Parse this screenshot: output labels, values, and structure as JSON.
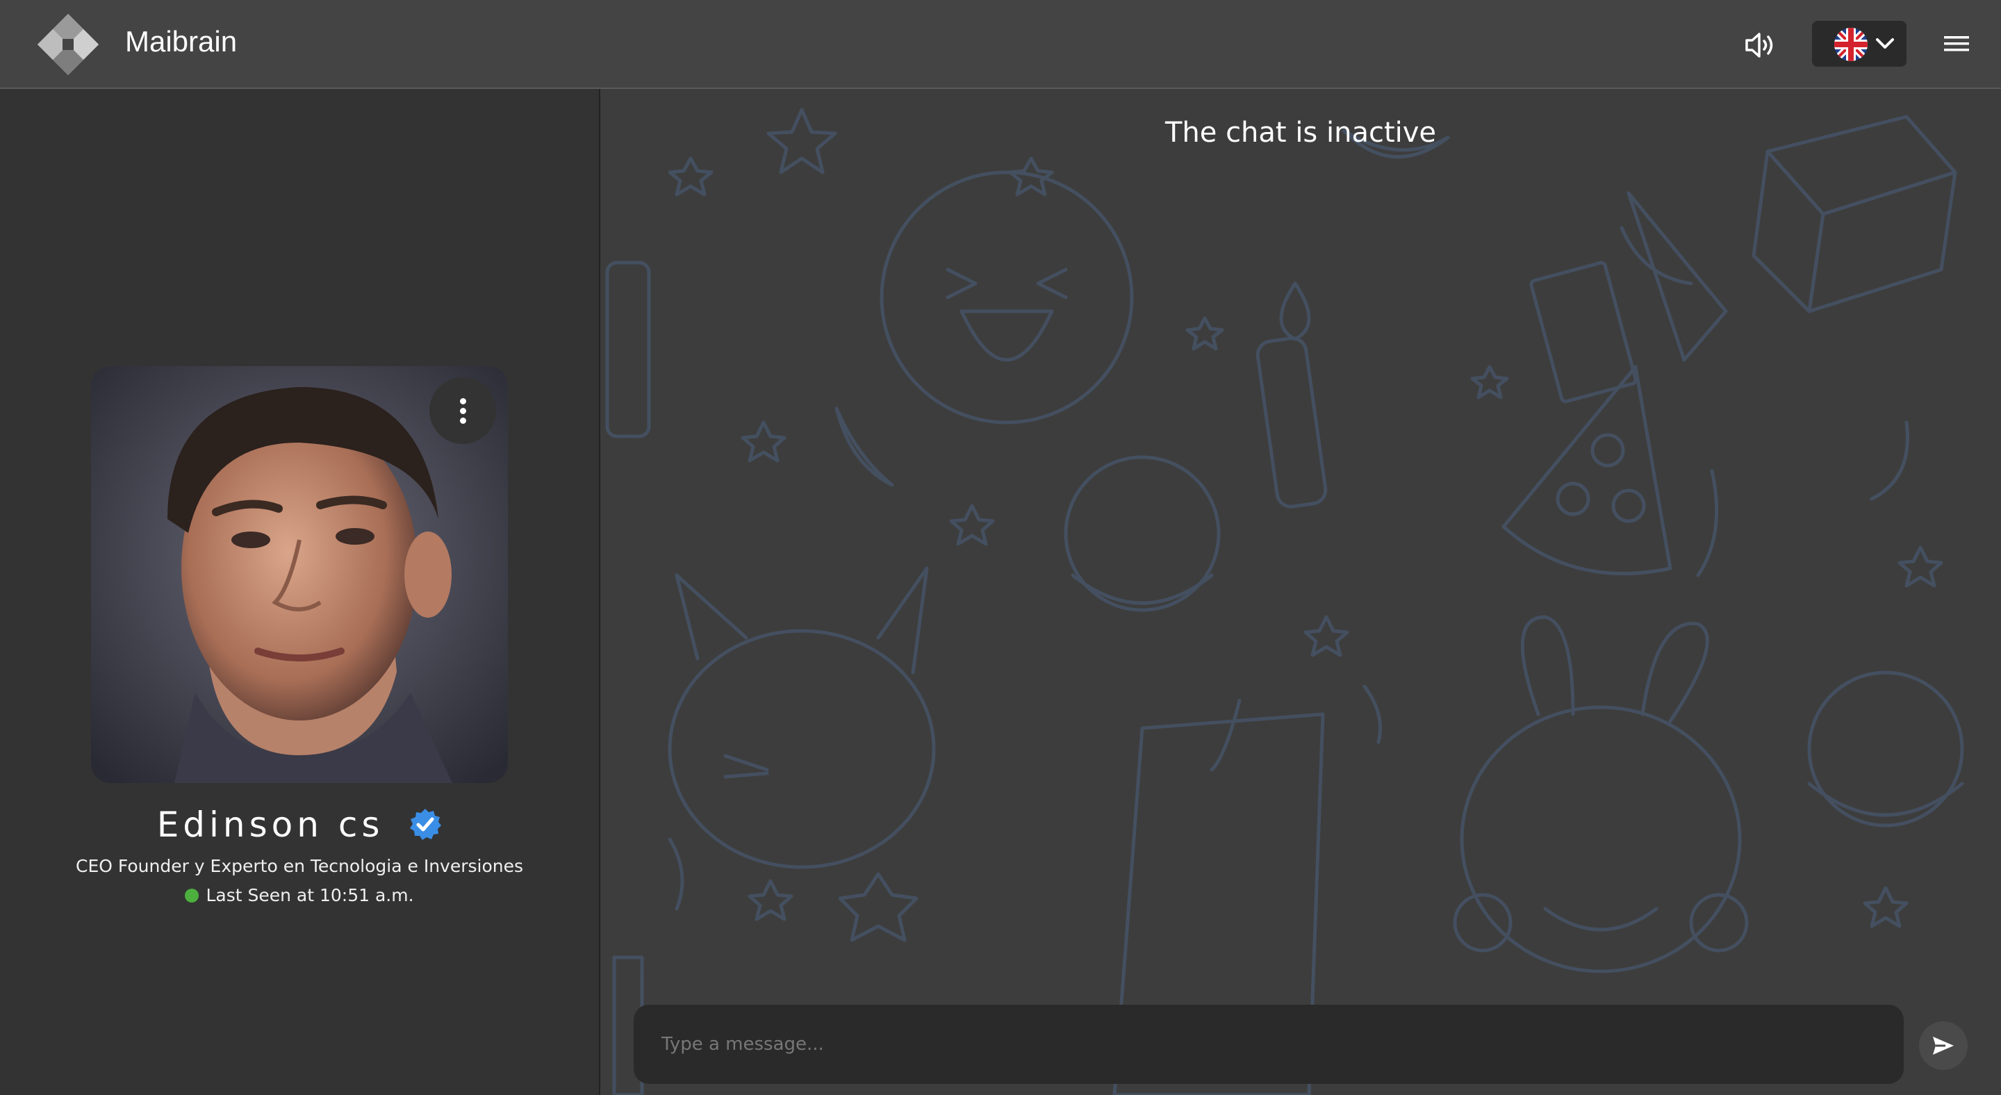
{
  "header": {
    "app_title": "Maibrain",
    "logo_icon": "maibrain-logo",
    "sound_icon": "speaker-icon",
    "language_flag": "uk-flag-icon",
    "menu_icon": "hamburger-menu-icon"
  },
  "profile": {
    "name": "Edinson cs",
    "title": "CEO Founder y Experto en Tecnologia e Inversiones",
    "last_seen": "Last Seen at 10:51 a.m.",
    "status_color": "#4caf3e",
    "verified_color": "#3a8ee6"
  },
  "chat": {
    "status_text": "The chat is inactive",
    "input_placeholder": "Type a message..."
  }
}
